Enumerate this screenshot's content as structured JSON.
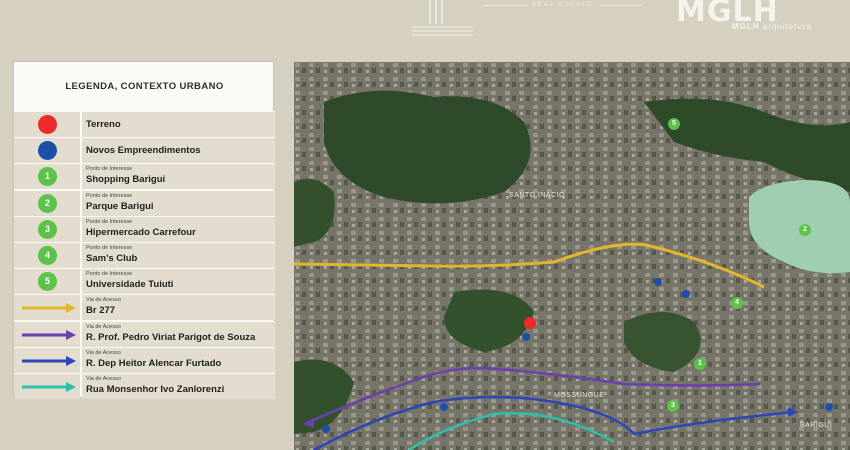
{
  "header": {
    "real_estate": "REAL ESTATE",
    "brand": "MGLH",
    "brand_sub_strong": "MGLH",
    "brand_sub_rest": " arquitetura"
  },
  "legend": {
    "title": "LEGENDA, CONTEXTO URBANO",
    "items": [
      {
        "kind": "dot",
        "color": "#ee2a2a",
        "number": "",
        "label": "Terreno"
      },
      {
        "kind": "dot",
        "color": "#1e4fa8",
        "number": "",
        "label": "Novos Empreendimentos"
      },
      {
        "kind": "poi",
        "color": "#5cc24a",
        "number": "1",
        "sublabel": "Ponto de Interesse",
        "label": "Shopping Barigui"
      },
      {
        "kind": "poi",
        "color": "#5cc24a",
        "number": "2",
        "sublabel": "Ponto de Interesse",
        "label": "Parque Barigui"
      },
      {
        "kind": "poi",
        "color": "#5cc24a",
        "number": "3",
        "sublabel": "Ponto de Interesse",
        "label": "Hipermercado Carrefour"
      },
      {
        "kind": "poi",
        "color": "#5cc24a",
        "number": "4",
        "sublabel": "Ponto de Interesse",
        "label": "Sam's Club"
      },
      {
        "kind": "poi",
        "color": "#5cc24a",
        "number": "5",
        "sublabel": "Ponto de Interesse",
        "label": "Universidade Tuiuti"
      },
      {
        "kind": "arrow",
        "color": "#e3b62a",
        "sublabel": "Via de Acesso",
        "label": "Br 277"
      },
      {
        "kind": "arrow",
        "color": "#6a3fb0",
        "sublabel": "Via de Acesso",
        "label": "R. Prof. Pedro Viriat Parigot de Souza"
      },
      {
        "kind": "arrow",
        "color": "#2d45b8",
        "sublabel": "Via de Acesso",
        "label": "R. Dep Heitor Alencar Furtado"
      },
      {
        "kind": "arrow",
        "color": "#2fbfa8",
        "sublabel": "Via de Acesso",
        "label": "Rua Monsenhor Ivo Zanlorenzi"
      }
    ]
  },
  "map": {
    "neighborhood_label": "SANTO INÁCIO",
    "label_mossungue": "MOSSUNGUE",
    "label_barigui": "BARIGUI",
    "pins": [
      "5",
      "2",
      "4",
      "1",
      "3"
    ]
  }
}
